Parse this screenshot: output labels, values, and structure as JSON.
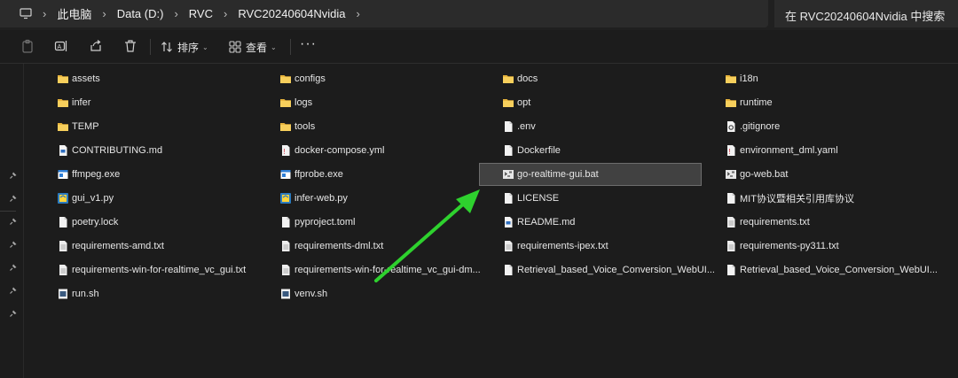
{
  "address_bar": {
    "crumbs": [
      "此电脑",
      "Data (D:)",
      "RVC",
      "RVC20240604Nvidia"
    ],
    "search_placeholder": "在 RVC20240604Nvidia 中搜索"
  },
  "toolbar": {
    "sort_label": "排序",
    "view_label": "查看"
  },
  "files": [
    {
      "name": "assets",
      "type": "folder"
    },
    {
      "name": "configs",
      "type": "folder"
    },
    {
      "name": "docs",
      "type": "folder"
    },
    {
      "name": "i18n",
      "type": "folder"
    },
    {
      "name": "infer",
      "type": "folder"
    },
    {
      "name": "logs",
      "type": "folder"
    },
    {
      "name": "opt",
      "type": "folder"
    },
    {
      "name": "runtime",
      "type": "folder"
    },
    {
      "name": "TEMP",
      "type": "folder"
    },
    {
      "name": "tools",
      "type": "folder"
    },
    {
      "name": ".env",
      "type": "file"
    },
    {
      "name": ".gitignore",
      "type": "gear"
    },
    {
      "name": "CONTRIBUTING.md",
      "type": "md"
    },
    {
      "name": "docker-compose.yml",
      "type": "yaml"
    },
    {
      "name": "Dockerfile",
      "type": "file"
    },
    {
      "name": "environment_dml.yaml",
      "type": "yaml"
    },
    {
      "name": "ffmpeg.exe",
      "type": "exe"
    },
    {
      "name": "ffprobe.exe",
      "type": "exe"
    },
    {
      "name": "go-realtime-gui.bat",
      "type": "bat",
      "selected": true
    },
    {
      "name": "go-web.bat",
      "type": "bat"
    },
    {
      "name": "gui_v1.py",
      "type": "py"
    },
    {
      "name": "infer-web.py",
      "type": "py"
    },
    {
      "name": "LICENSE",
      "type": "file"
    },
    {
      "name": "MIT协议暨相关引用库协议",
      "type": "file"
    },
    {
      "name": "poetry.lock",
      "type": "file"
    },
    {
      "name": "pyproject.toml",
      "type": "file"
    },
    {
      "name": "README.md",
      "type": "md"
    },
    {
      "name": "requirements.txt",
      "type": "txt"
    },
    {
      "name": "requirements-amd.txt",
      "type": "txt"
    },
    {
      "name": "requirements-dml.txt",
      "type": "txt"
    },
    {
      "name": "requirements-ipex.txt",
      "type": "txt"
    },
    {
      "name": "requirements-py311.txt",
      "type": "txt"
    },
    {
      "name": "requirements-win-for-realtime_vc_gui.txt",
      "type": "txt"
    },
    {
      "name": "requirements-win-for-realtime_vc_gui-dm...",
      "type": "txt"
    },
    {
      "name": "Retrieval_based_Voice_Conversion_WebUI...",
      "type": "file"
    },
    {
      "name": "Retrieval_based_Voice_Conversion_WebUI...",
      "type": "file"
    },
    {
      "name": "run.sh",
      "type": "sh"
    },
    {
      "name": "venv.sh",
      "type": "sh"
    }
  ],
  "annotation": {
    "color": "#2ed12e"
  }
}
